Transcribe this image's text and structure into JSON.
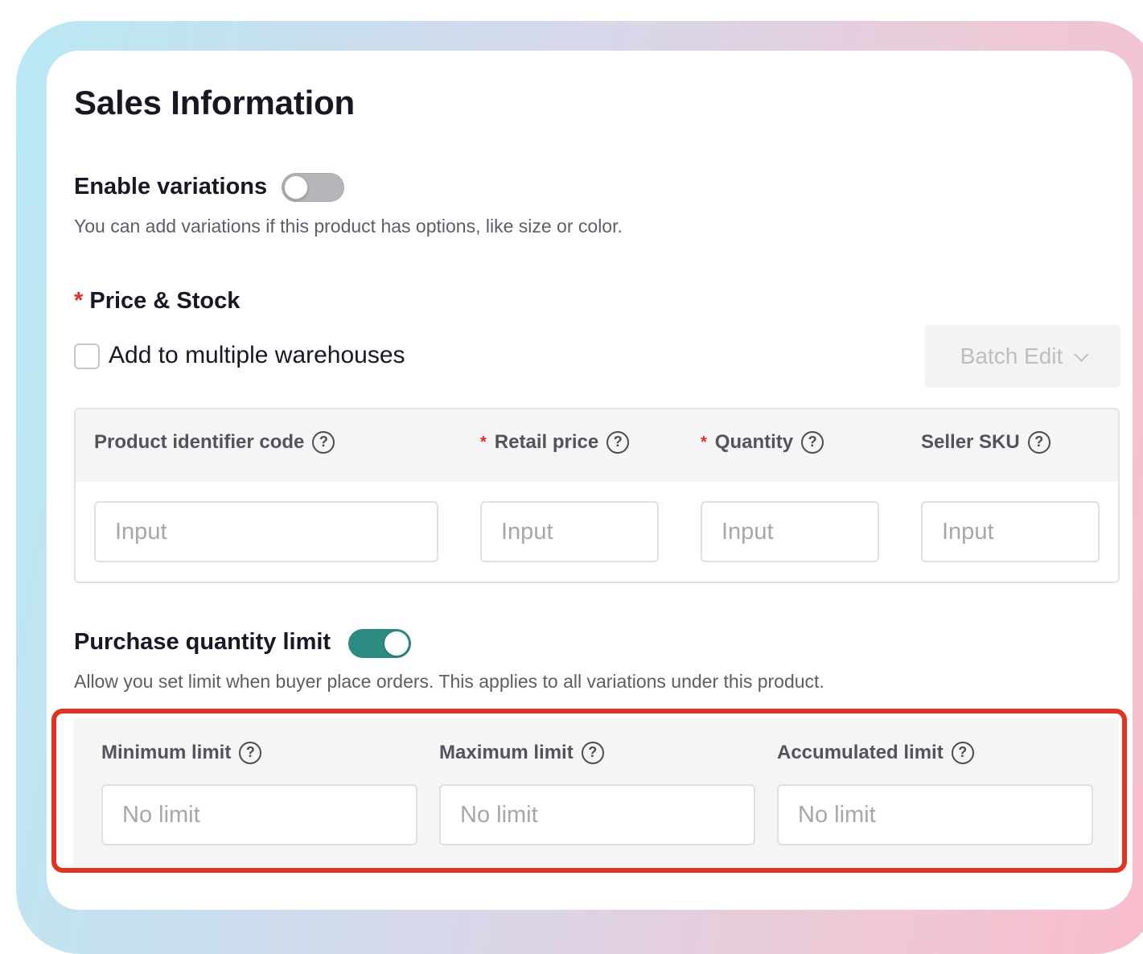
{
  "section": {
    "title": "Sales Information"
  },
  "variations": {
    "label": "Enable variations",
    "enabled": false,
    "description": "You can add variations if this product has options, like size or color."
  },
  "price_stock": {
    "required_mark": "*",
    "label": "Price & Stock",
    "multi_warehouse_label": "Add to multiple warehouses",
    "multi_warehouse_checked": false,
    "batch_edit_label": "Batch Edit",
    "columns": [
      {
        "label": "Product identifier code",
        "required": false,
        "placeholder": "Input"
      },
      {
        "label": "Retail price",
        "required": true,
        "placeholder": "Input"
      },
      {
        "label": "Quantity",
        "required": true,
        "placeholder": "Input"
      },
      {
        "label": "Seller SKU",
        "required": false,
        "placeholder": "Input"
      }
    ]
  },
  "purchase_limit": {
    "label": "Purchase quantity limit",
    "enabled": true,
    "description": "Allow you set limit when buyer place orders. This applies to all variations under this product.",
    "fields": [
      {
        "label": "Minimum limit",
        "placeholder": "No limit"
      },
      {
        "label": "Maximum limit",
        "placeholder": "No limit"
      },
      {
        "label": "Accumulated limit",
        "placeholder": "No limit"
      }
    ]
  },
  "icons": {
    "help": "?"
  },
  "colors": {
    "toggle_on": "#2b8c82",
    "toggle_off": "#b5b6ba",
    "required": "#e02e24",
    "highlight": "#e3321f"
  }
}
